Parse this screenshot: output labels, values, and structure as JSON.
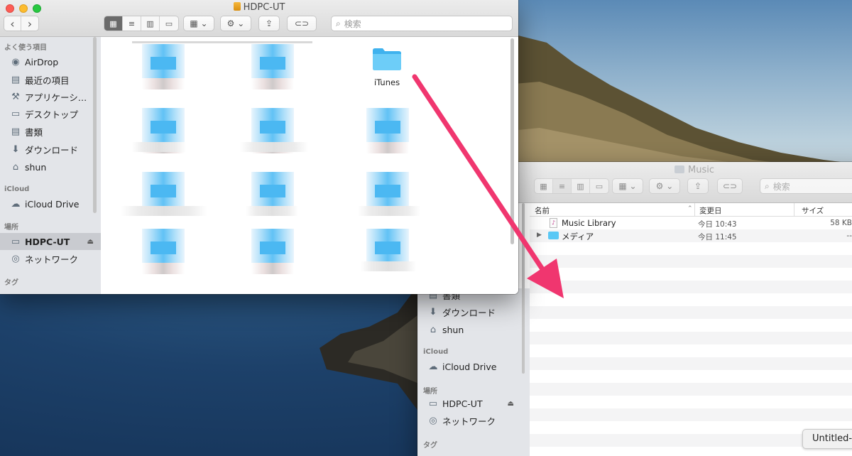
{
  "front_window": {
    "title": "HDPC-UT",
    "search_placeholder": "検索",
    "nav": {
      "back": "‹",
      "forward": "›"
    },
    "sidebar": {
      "favorites_header": "よく使う項目",
      "favorites": [
        {
          "label": "AirDrop",
          "icon": "airdrop-icon"
        },
        {
          "label": "最近の項目",
          "icon": "recents-icon"
        },
        {
          "label": "アプリケーシ…",
          "icon": "applications-icon"
        },
        {
          "label": "デスクトップ",
          "icon": "desktop-icon"
        },
        {
          "label": "書類",
          "icon": "documents-icon"
        },
        {
          "label": "ダウンロード",
          "icon": "downloads-icon"
        },
        {
          "label": "shun",
          "icon": "home-icon"
        }
      ],
      "icloud_header": "iCloud",
      "icloud": [
        {
          "label": "iCloud Drive",
          "icon": "cloud-icon"
        }
      ],
      "locations_header": "場所",
      "locations": [
        {
          "label": "HDPC-UT",
          "icon": "drive-icon",
          "selected": true
        },
        {
          "label": "ネットワーク",
          "icon": "network-icon"
        }
      ],
      "tags_header": "タグ"
    },
    "folder": {
      "name": "iTunes",
      "icon": "folder-icon"
    }
  },
  "back_window": {
    "title": "Music",
    "search_placeholder": "検索",
    "sidebar": {
      "items_top": [
        {
          "label": "書類",
          "icon": "documents-icon"
        },
        {
          "label": "ダウンロード",
          "icon": "downloads-icon"
        },
        {
          "label": "shun",
          "icon": "home-icon"
        }
      ],
      "icloud_header": "iCloud",
      "icloud": [
        {
          "label": "iCloud Drive",
          "icon": "cloud-icon"
        }
      ],
      "locations_header": "場所",
      "locations": [
        {
          "label": "HDPC-UT",
          "icon": "drive-icon"
        },
        {
          "label": "ネットワーク",
          "icon": "network-icon"
        }
      ],
      "tags_header": "タグ"
    },
    "columns": {
      "name": "名前",
      "modified": "変更日",
      "size": "サイズ"
    },
    "rows": [
      {
        "name": "Music Library",
        "modified": "今日 10:43",
        "size": "58 KB",
        "icon": "document-icon"
      },
      {
        "name": "メディア",
        "modified": "今日 11:45",
        "size": "--",
        "icon": "folder-icon"
      }
    ]
  },
  "tooltip": "Untitled-",
  "colors": {
    "arrow": "#f0366f",
    "folder": "#5ac8f5",
    "selection": "#c9cbd0"
  }
}
